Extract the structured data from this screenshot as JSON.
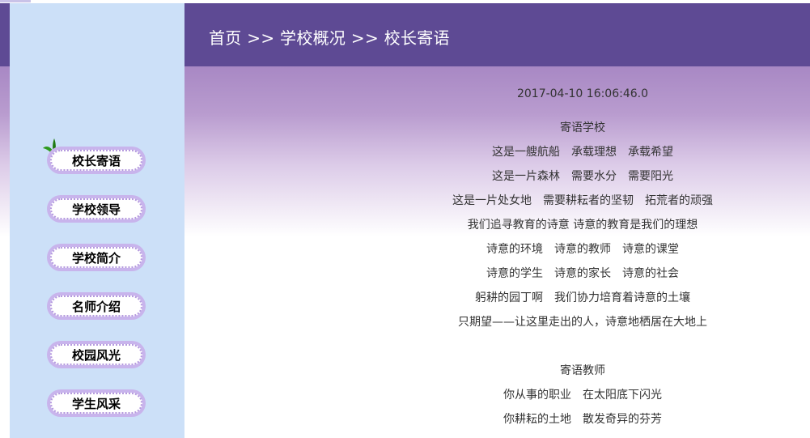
{
  "header": {
    "breadcrumb": "首页 >> 学校概况 >> 校长寄语"
  },
  "sidebar": {
    "menu": [
      {
        "label": "校长寄语",
        "active": true
      },
      {
        "label": "学校领导"
      },
      {
        "label": "学校简介"
      },
      {
        "label": "名师介绍"
      },
      {
        "label": "校园风光"
      },
      {
        "label": "学生风采"
      }
    ]
  },
  "article": {
    "date": "2017-04-10 16:06:46.0",
    "lines": [
      "寄语学校",
      "这是一艘航船　承载理想　承载希望",
      "这是一片森林　需要水分　需要阳光",
      "这是一片处女地　需要耕耘者的坚韧　拓荒者的顽强",
      "我们追寻教育的诗意 诗意的教育是我们的理想",
      "诗意的环境　诗意的教师　诗意的课堂",
      "诗意的学生　诗意的家长　诗意的社会",
      "躬耕的园丁啊　我们协力培育着诗意的土壤",
      "只期望——让这里走出的人，诗意地栖居在大地上",
      "",
      "寄语教师",
      "你从事的职业　在太阳底下闪光",
      "你耕耘的土地　散发奇异的芬芳"
    ]
  },
  "colors": {
    "header_bg": "#5e4a94",
    "sidebar_bg": "#cce0f8",
    "menu_border": "#c8b4ec"
  }
}
